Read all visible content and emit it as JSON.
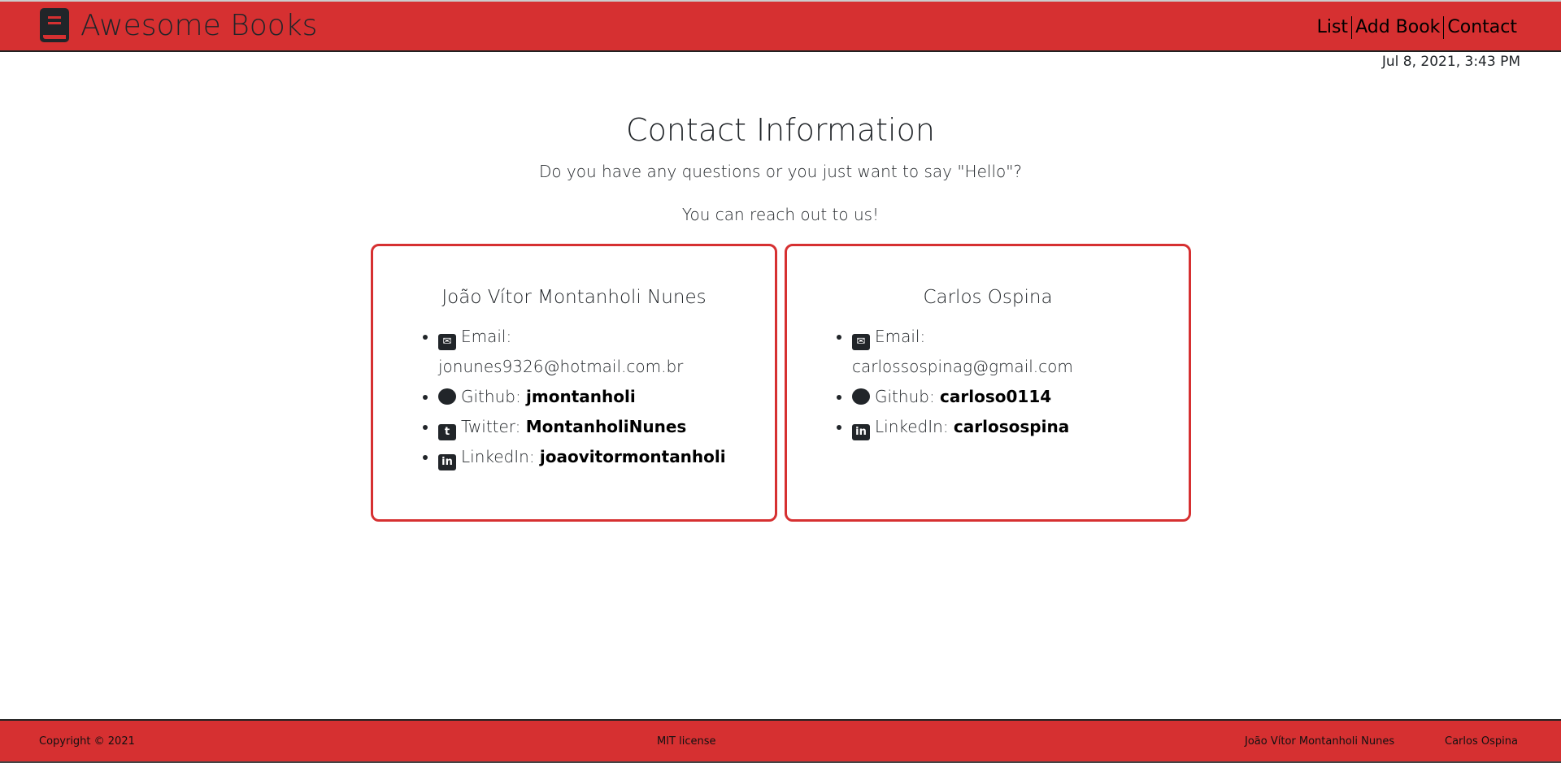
{
  "header": {
    "title": "Awesome Books",
    "nav": [
      "List",
      "Add Book",
      "Contact"
    ],
    "date": "Jul 8, 2021, 3:43 PM"
  },
  "main": {
    "title": "Contact Information",
    "subtitle": "Do you have any questions or you just want to say \"Hello\"?",
    "subtitle2": "You can reach out to us!"
  },
  "contacts": [
    {
      "name": "João Vítor Montanholi Nunes",
      "email_label": "Email:",
      "email": "jonunes9326@hotmail.com.br",
      "github_label": "Github:",
      "github": "jmontanholi",
      "twitter_label": "Twitter:",
      "twitter": "MontanholiNunes",
      "linkedin_label": "LinkedIn:",
      "linkedin": "joaovitormontanholi"
    },
    {
      "name": "Carlos Ospina",
      "email_label": "Email:",
      "email": "carlossospinag@gmail.com",
      "github_label": "Github:",
      "github": "carloso0114",
      "linkedin_label": "LinkedIn:",
      "linkedin": "carlosospina"
    }
  ],
  "footer": {
    "copyright": "Copyright © 2021",
    "license": "MIT license",
    "authors": [
      "João Vítor Montanholi Nunes",
      "Carlos Ospina"
    ]
  },
  "colors": {
    "brand": "#d63031",
    "text": "#212529"
  }
}
